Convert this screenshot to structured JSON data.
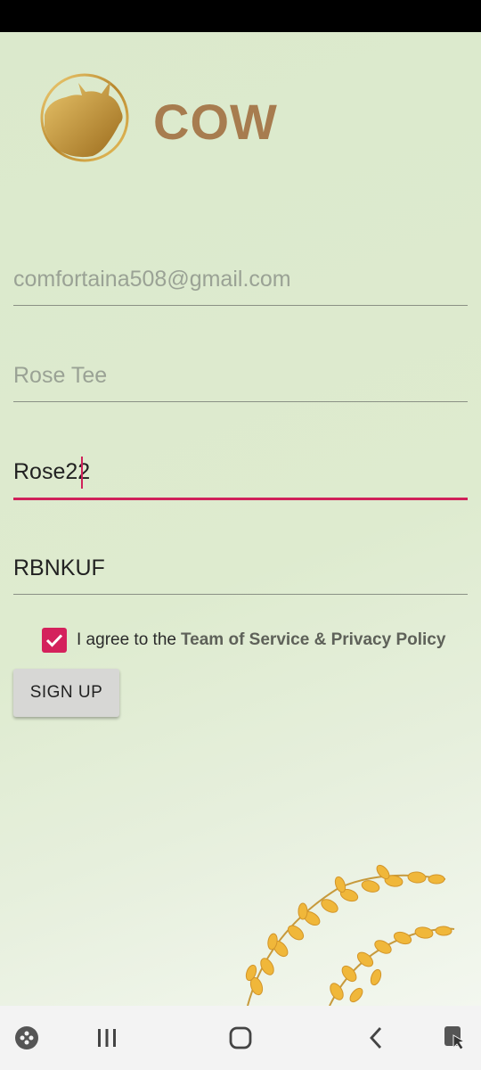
{
  "app": {
    "brand_name": "COW",
    "logo_icon": "cow-head-gold-circle-icon",
    "brand_color": "#a77c4f",
    "accent_color": "#d0215a"
  },
  "form": {
    "email": {
      "value": "",
      "placeholder": "comfortaina508@gmail.com"
    },
    "full_name": {
      "value": "",
      "placeholder": "Rose Tee"
    },
    "username": {
      "value": "Rose22",
      "placeholder": ""
    },
    "referral_code": {
      "value": "RBNKUF",
      "placeholder": ""
    },
    "agree": {
      "checked": true,
      "text": "I agree to the",
      "link_text": "Team of Service & Privacy Policy"
    },
    "signup_label": "SIGN UP"
  },
  "navigation_bar": {
    "buttons": [
      "game-launcher-icon",
      "recent-apps-icon",
      "home-icon",
      "back-icon",
      "screen-touch-icon"
    ]
  }
}
